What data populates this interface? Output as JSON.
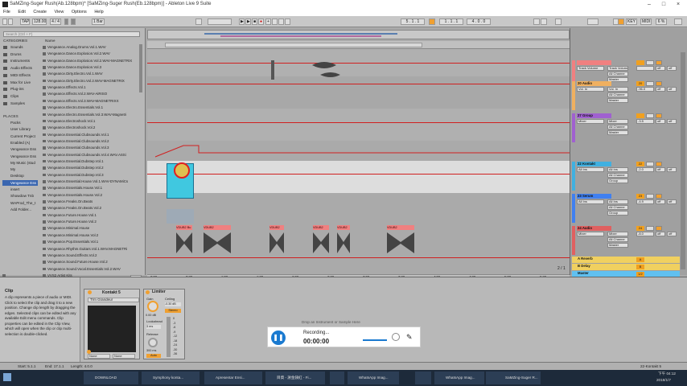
{
  "title": "SaMZing-Suger Rush(Ab.128bpm)* [SaMZing-Suger Rush(Eb.128bpm)] - Ableton Live 9 Suite",
  "menu": [
    "File",
    "Edit",
    "Create",
    "View",
    "Options",
    "Help"
  ],
  "toolbar": {
    "tap": "TAP",
    "tempo": "128.00",
    "meter": "4 / 4",
    "quant": "1 Bar",
    "position": "5 . 1 . 1",
    "loop_start": "1 . 1 . 1",
    "loop_length": "4 . 0 . 0",
    "key": "KEY",
    "midi": "MIDI",
    "cpu": "6 %"
  },
  "browser": {
    "search_placeholder": "Search (Ctrl + F)",
    "categories_header": "CATEGORIES",
    "categories": [
      "Sounds",
      "Drums",
      "Instruments",
      "Audio Effects",
      "MIDI Effects",
      "Max for Live",
      "Plug-ins",
      "Clips",
      "Samples"
    ],
    "places_header": "PLACES",
    "places": [
      "Packs",
      "User Library",
      "Current Project",
      "Enabled (A)",
      "Vengeance Ess",
      "Vengeance Ess",
      "My Music (stud",
      "My",
      "Desktop",
      "Vengeance Ess",
      "insert",
      "Showdow Tnb",
      "WAProd_The_t",
      "Add Folder..."
    ],
    "name_header": "Name",
    "files": [
      "Vengeance.Analog.Drums.Vol.1.WAV",
      "Vengeance.Dance.Explosion.Vol.2.WAV",
      "Vengeance.Dance.Explosion.Vol.2.WAV-MAGNETRIX",
      "Vengeance.Dance.Explosion.Vol.3",
      "Vengeance.Dirty.Electro.Vol.1.WAV",
      "Vengeance.Dirty.Electro.Vol.2.WAV-MAGNETRIX",
      "Vengeance.Effects.Vol.1",
      "Vengeance.Effects.Vol.2.WAV-AiRISO",
      "Vengeance.Effects.Vol.3.WAV-MAGNETRIXX",
      "Vengeance.Electro.Essentials.Vol.1",
      "Vengeance.Electro.Essentials.Vol.3.WAV-Magnetri",
      "Vengeance.Electroshock.Vol.1",
      "Vengeance.Electroshock.Vol.2",
      "Vengeance.Essential.Clubsounds.Vol.1",
      "Vengeance.Essential.Clubsounds.Vol.2",
      "Vengeance.Essential.Clubsounds.Vol.3",
      "Vengeance.Essential.Clubsounds.Vol.4.WAV.ASSi",
      "Vengeance.Essential.Dubstep.Vol.1",
      "Vengeance.Essential.Dubstep.Vol.2",
      "Vengeance.Essential.Dubstep.Vol.3",
      "Vengeance.Essential.House.Vol.1.WAV-DYNAMiCs",
      "Vengeance.Essentials.House.Vol.1",
      "Vengeance.Essentials.House.Vol.2",
      "Vengeance.Freaks.On.Beats",
      "Vengeance.Freaks.On.Beats.Vol.2",
      "Vengeance.Future.House.Vol.1",
      "Vengeance.Future.House.Vol.2",
      "Vengeance.Minimal.House",
      "Vengeance.Minimal.House.Vol.2",
      "Vengeance.Pop.Essentials.Vol.1",
      "Vengeance.Rhythm.Guitars.Vol.1.WAV.MAGNETRi",
      "Vengeance.Sound.Effects.Vol.2",
      "Vengeance.Sound.Future.House.Vol.2",
      "Vengeance.Sound.Vocal.Essentials.Vol.2.WAV",
      "VVS2 Artist Kits"
    ],
    "raw_label": "Raw"
  },
  "arrangement": {
    "clip_labels": [
      "VDUB2 Bu",
      "VDUB2",
      "VDUB2",
      "VDUB2",
      "VDUB2",
      "VDUB2"
    ],
    "time_labels": [
      "0:00",
      "0:30",
      "1:00",
      "1:30",
      "2:00",
      "2:30",
      "3:00",
      "3:30",
      "4:00",
      "4:30",
      "5:00",
      "5:30"
    ],
    "page": "2 / 1"
  },
  "mixer": {
    "tracks": [
      {
        "name": "",
        "in": "Track Volume",
        "vol": "",
        "pan": "",
        "color": "#f08080",
        "extra": "Master"
      },
      {
        "name": "20 Audio",
        "in": "Vol. In",
        "vol": "20",
        "pan": "-96.0",
        "color": "#f0b060",
        "extra": "Master"
      },
      {
        "name": "27 Group",
        "in": "Mixer",
        "vol": "",
        "pan": "-3.5",
        "color": "#a060d0",
        "extra": "Master"
      },
      {
        "name": "22 Kontakt",
        "in": "All Ins",
        "vol": "22",
        "pan": "-2.0",
        "color": "#40b0e0",
        "extra": "Group"
      },
      {
        "name": "23 Serum",
        "in": "All Ins",
        "vol": "23",
        "pan": "-4.9",
        "color": "#4080f0",
        "extra": "Group"
      },
      {
        "name": "24 Audio",
        "in": "Mixer",
        "vol": "24",
        "pan": "-8.0",
        "color": "#e06060",
        "extra": "Master"
      }
    ],
    "returns": [
      {
        "name": "A Reverb",
        "vol": "A"
      },
      {
        "name": "B Delay",
        "vol": "B"
      },
      {
        "name": "Master",
        "vol": "1/2"
      }
    ],
    "labels": {
      "post": "Post",
      "off": "off",
      "eq": "EQ Eight",
      "freq": "4 Frequency A",
      "limiter": "Limiter",
      "gain": "Gain",
      "all_channels": "All Channe"
    }
  },
  "detail": {
    "info_title": "Clip",
    "info_text": "A clip represents a piece of audio or MIDI. Click to select the clip and drag it to a new position. Change clip length by dragging the edges. Selected clips can be edited with any available Edit menu commands. Clip properties can be edited in the Clip View, which will open when the clip or clip multi-selection is double-clicked.",
    "kontakt_label": "Kontakt 5",
    "kontakt_preset": "Trm Grandeur",
    "none1": "None",
    "none2": "None",
    "limiter_label": "Limiter",
    "gain_label": "Gain",
    "gain_val": "0.00 dB",
    "ceiling_label": "Ceiling",
    "ceiling_val": "-0.30 dB",
    "stereo": "Stereo",
    "lookahead": "Lookahead",
    "lookahead_val": "3 ms",
    "release": "Release",
    "release_val": "300 ms",
    "auto": "Auto",
    "drop_hint": "Drop an Instrument or Sample Here",
    "meter_scale": [
      "0",
      "-3",
      "-6",
      "-9",
      "-12",
      "-18",
      "-24",
      "-30",
      "-36"
    ]
  },
  "status_bar": {
    "start": "Start: 5.1.1",
    "end": "End: 17.1.1",
    "length": "Length: 4.0.0",
    "track": "22-Kontakt 5"
  },
  "recorder": {
    "label": "Recording...",
    "time": "00:00:00"
  },
  "taskbar": {
    "items": [
      "DOWNLOAD",
      "Symphony konta...",
      "Apresentar Ensi...",
      "目資 - 謝金銕紅 - Fi...",
      "",
      "WhatsApp Imag...",
      "",
      "WhatsApp Imag...",
      "WhatsApp Imag...",
      "SaMZing-Suger R..."
    ],
    "clock": "下午 04:12",
    "date": "2018/1/7"
  },
  "colors": {
    "accent": "#f0a030",
    "selected": "#3a66b0",
    "clip": "#40c8e0",
    "redline": "#d02020"
  }
}
